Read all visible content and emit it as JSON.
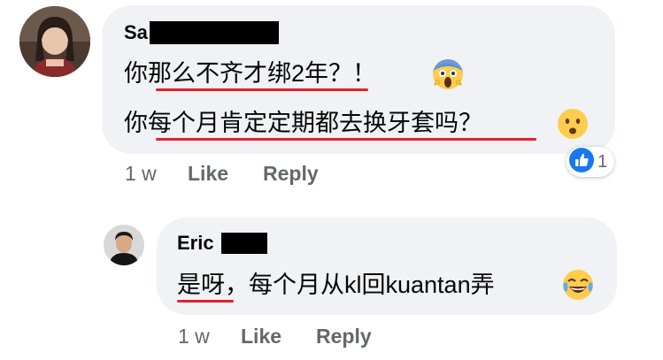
{
  "colors": {
    "bubble": "#f0f2f5",
    "meta_text": "#65676b",
    "underline": "#e4202b",
    "like_blue": "#1877f2"
  },
  "comment": {
    "author_visible": "Sa",
    "avatar": "user-photo-woman",
    "line1": "你那么不齐才绑2年？！",
    "line1_emoji": "face-screaming-in-fear-icon",
    "line2": "你每个月肯定定期都去换牙套吗？",
    "line2_emoji": "frowning-face-icon",
    "time": "1 w",
    "like_label": "Like",
    "reply_label": "Reply",
    "reaction_icon": "thumbs-up-icon",
    "reaction_count": "1"
  },
  "reply": {
    "author_visible": "Eric",
    "avatar": "user-photo-man",
    "text": "是呀，每个月从kl回kuantan弄",
    "emoji": "face-with-tears-of-joy-icon",
    "time": "1 w",
    "like_label": "Like",
    "reply_label": "Reply"
  }
}
